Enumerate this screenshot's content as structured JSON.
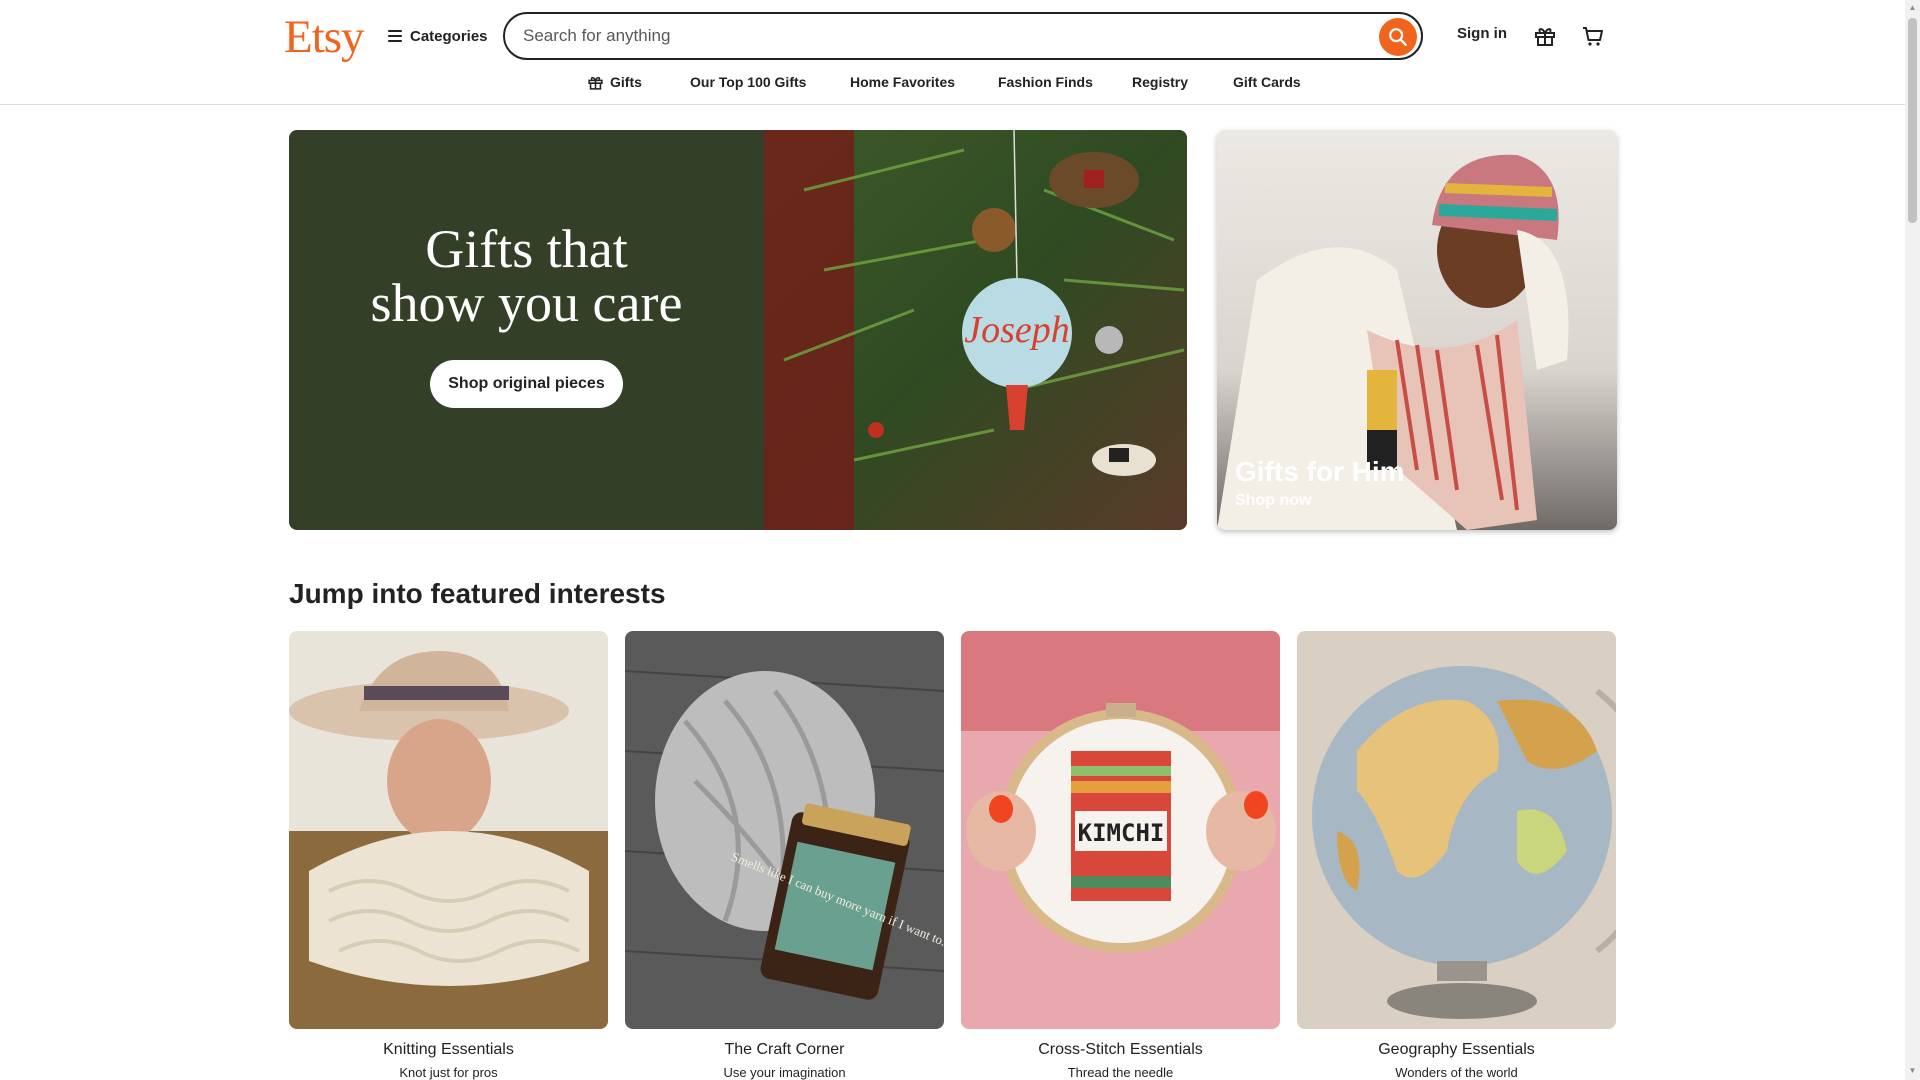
{
  "header": {
    "logo": "Etsy",
    "categories_label": "Categories",
    "search_placeholder": "Search for anything",
    "sign_in": "Sign in"
  },
  "nav": [
    {
      "label": "Gifts",
      "icon": "gift-icon"
    },
    {
      "label": "Our Top 100 Gifts"
    },
    {
      "label": "Home Favorites"
    },
    {
      "label": "Fashion Finds"
    },
    {
      "label": "Registry"
    },
    {
      "label": "Gift Cards"
    }
  ],
  "hero": {
    "title_line1": "Gifts that",
    "title_line2": "show you care",
    "button": "Shop original pieces",
    "ornament_text": "Joseph"
  },
  "side_card": {
    "title": "Gifts for Him",
    "subtitle": "Shop now"
  },
  "featured": {
    "title": "Jump into featured interests",
    "items": [
      {
        "label": "Knitting Essentials",
        "sub": "Knot just for pros"
      },
      {
        "label": "The Craft Corner",
        "sub": "Use your imagination",
        "jar_text": "Smells like I can buy more yarn if I want to."
      },
      {
        "label": "Cross-Stitch Essentials",
        "sub": "Thread the needle",
        "hoop_text": "KIMCHI"
      },
      {
        "label": "Geography Essentials",
        "sub": "Wonders of the world"
      }
    ]
  },
  "colors": {
    "brand": "#f1641e",
    "hero_bg": "#343f27",
    "text": "#222222"
  }
}
